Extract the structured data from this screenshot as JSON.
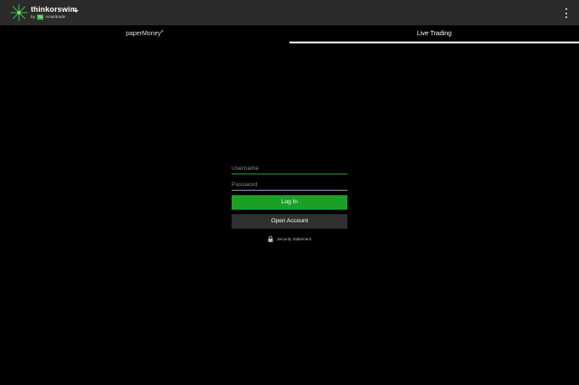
{
  "app": {
    "brand_name": "thinkorswim",
    "brand_sub_prefix": "by",
    "brand_sub_td": "TD",
    "brand_sub_suffix": "Ameritrade"
  },
  "tabs": [
    {
      "label": "paperMoney",
      "superscript": "®",
      "selected": false
    },
    {
      "label": "Live Trading",
      "selected": true
    }
  ],
  "login": {
    "username_placeholder": "Username",
    "password_placeholder": "Password",
    "login_label": "Log In",
    "open_account_label": "Open Account",
    "security_label": "Security Statement"
  },
  "colors": {
    "topbar": "#2b2b2b",
    "login_button": "#1aa027",
    "open_account_button": "#2f2f2f",
    "background": "#000000"
  },
  "icons": [
    "thinkorswim-logo",
    "dropdown-caret-icon",
    "more-vert-icon",
    "lock-icon"
  ]
}
